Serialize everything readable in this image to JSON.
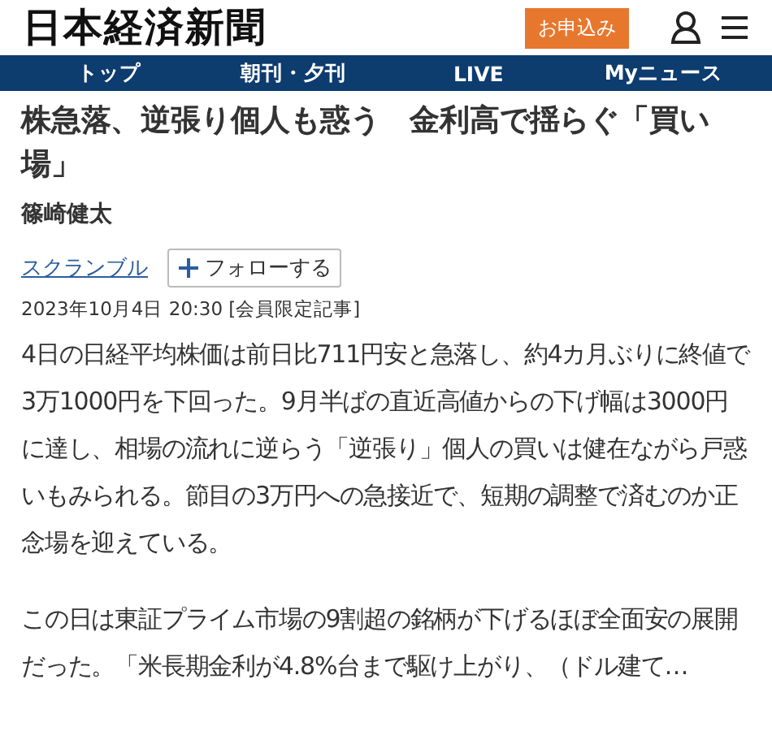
{
  "header": {
    "logo": "日本経済新聞",
    "subscribe_button": "お申込み"
  },
  "nav": {
    "items": [
      {
        "label": "トップ"
      },
      {
        "label": "朝刊・夕刊"
      },
      {
        "label": "LIVE"
      },
      {
        "label": "Myニュース"
      }
    ]
  },
  "article": {
    "title": "株急落、逆張り個人も惑う　金利高で揺らぐ「買い場」",
    "author": "篠崎健太",
    "topic": "スクランブル",
    "follow_button": "フォローする",
    "date": "2023年10月4日 20:30 [会員限定記事]",
    "paragraphs": [
      "4日の日経平均株価は前日比711円安と急落し、約4カ月ぶりに終値で3万1000円を下回った。9月半ばの直近高値からの下げ幅は3000円に達し、相場の流れに逆らう「逆張り」個人の買いは健在ながら戸惑いもみられる。節目の3万円への急接近で、短期の調整で済むのか正念場を迎えている。",
      "この日は東証プライム市場の9割超の銘柄が下げるほぼ全面安の展開だった。「米長期金利が4.8%台まで駆け上がり、（ドル建て…"
    ]
  }
}
